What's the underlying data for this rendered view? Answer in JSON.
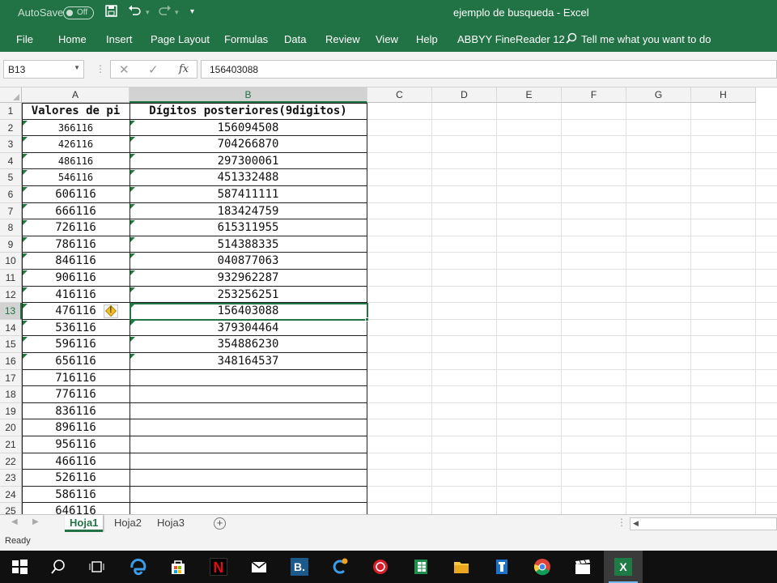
{
  "window": {
    "title": "ejemplo de busqueda  -  Excel",
    "autosave_label": "AutoSave",
    "autosave_state": "Off",
    "qat_icons": [
      "save-icon",
      "undo-icon",
      "redo-icon",
      "customize-qat-icon"
    ]
  },
  "ribbon": {
    "tabs": [
      "File",
      "Home",
      "Insert",
      "Page Layout",
      "Formulas",
      "Data",
      "Review",
      "View",
      "Help",
      "ABBYY FineReader 12"
    ],
    "tell_me": "Tell me what you want to do"
  },
  "formula_bar": {
    "name_box": "B13",
    "cancel_icon": "✕",
    "enter_icon": "✓",
    "fx_label": "fx",
    "value": "156403088"
  },
  "columns": [
    "A",
    "B",
    "C",
    "D",
    "E",
    "F",
    "G",
    "H"
  ],
  "rows": [
    "1",
    "2",
    "3",
    "4",
    "5",
    "6",
    "7",
    "8",
    "9",
    "10",
    "11",
    "12",
    "13",
    "14",
    "15",
    "16",
    "17",
    "18",
    "19",
    "20",
    "21",
    "22",
    "23",
    "24",
    "25"
  ],
  "selected_cell": {
    "column": "B",
    "row": "13"
  },
  "table": {
    "header_a": "Valores de pi",
    "header_b": "Dígitos posteriores(9digitos)",
    "col_a": [
      "366116",
      "426116",
      "486116",
      "546116",
      "606116",
      "666116",
      "726116",
      "786116",
      "846116",
      "906116",
      "416116",
      "476116",
      "536116",
      "596116",
      "656116",
      "716116",
      "776116",
      "836116",
      "896116",
      "956116",
      "466116",
      "526116",
      "586116",
      "646116"
    ],
    "col_b": [
      "156094508",
      "704266870",
      "297300061",
      "451332488",
      "587411111",
      "183424759",
      "615311955",
      "514388335",
      "040877063",
      "932962287",
      "253256251",
      "156403088",
      "379304464",
      "354886230",
      "348164537"
    ]
  },
  "error_indicator": {
    "row": "13",
    "icon": "warning-icon",
    "symbol": "!"
  },
  "sheets": {
    "tabs": [
      "Hoja1",
      "Hoja2",
      "Hoja3"
    ],
    "active": "Hoja1",
    "add_symbol": "+"
  },
  "status": {
    "text": "Ready"
  },
  "taskbar": {
    "icons": [
      "windows-start-icon",
      "search-icon",
      "task-view-icon",
      "edge-icon",
      "store-icon",
      "netflix-icon",
      "mail-icon",
      "b-app-icon",
      "c-app-icon",
      "red-app-icon",
      "excel-file-icon",
      "file-explorer-icon",
      "blue-tool-icon",
      "chrome-icon",
      "video-editor-icon",
      "excel-icon"
    ],
    "netflix_letter": "N",
    "b_letter": "B.",
    "excel_letter": "X"
  },
  "colors": {
    "excel_green": "#217346",
    "grid_line": "#e1e1e1",
    "taskbar": "#101010"
  }
}
